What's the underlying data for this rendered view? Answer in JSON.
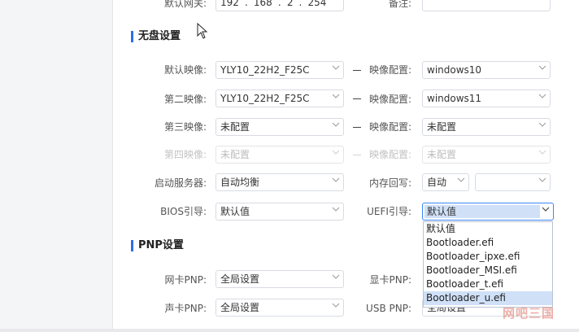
{
  "top_row": {
    "gateway_label": "默认网关:",
    "gateway_ip": [
      "192",
      "168",
      "2",
      "254"
    ],
    "note_label": "备注:",
    "note_value": ""
  },
  "diskless": {
    "section_title": "无盘设置",
    "rows": [
      {
        "label": "默认映像:",
        "image": "YLY10_22H2_F25C",
        "config_label": "映像配置:",
        "config": "windows10",
        "disabled": false
      },
      {
        "label": "第二映像:",
        "image": "YLY10_22H2_F25C",
        "config_label": "映像配置:",
        "config": "windows11",
        "disabled": false
      },
      {
        "label": "第三映像:",
        "image": "未配置",
        "config_label": "映像配置:",
        "config": "未配置",
        "disabled": false
      },
      {
        "label": "第四映像:",
        "image": "未配置",
        "config_label": "映像配置:",
        "config": "未配置",
        "disabled": true
      }
    ],
    "boot_server_label": "启动服务器:",
    "boot_server_value": "自动均衡",
    "memory_label": "内存回写:",
    "memory_value": "自动",
    "memory_extra": "",
    "bios_label": "BIOS引导:",
    "bios_value": "默认值",
    "uefi_label": "UEFI引导:",
    "uefi_value": "默认值",
    "uefi_options": [
      "默认值",
      "Bootloader.efi",
      "Bootloader_ipxe.efi",
      "Bootloader_MSI.efi",
      "Bootloader_t.efi",
      "Bootloader_u.efi"
    ],
    "uefi_highlighted_index": 5
  },
  "pnp": {
    "section_title": "PNP设置",
    "nic_label": "网卡PNP:",
    "nic_value": "全局设置",
    "gpu_label": "显卡PNP:",
    "sound_label": "声卡PNP:",
    "sound_value": "全局设置",
    "usb_label": "USB PNP:",
    "usb_value": "全局设置"
  },
  "watermark": "网吧三国",
  "colors": {
    "accent": "#2d6fe6",
    "highlight": "#cfe0f7",
    "border": "#d7dbe2"
  }
}
